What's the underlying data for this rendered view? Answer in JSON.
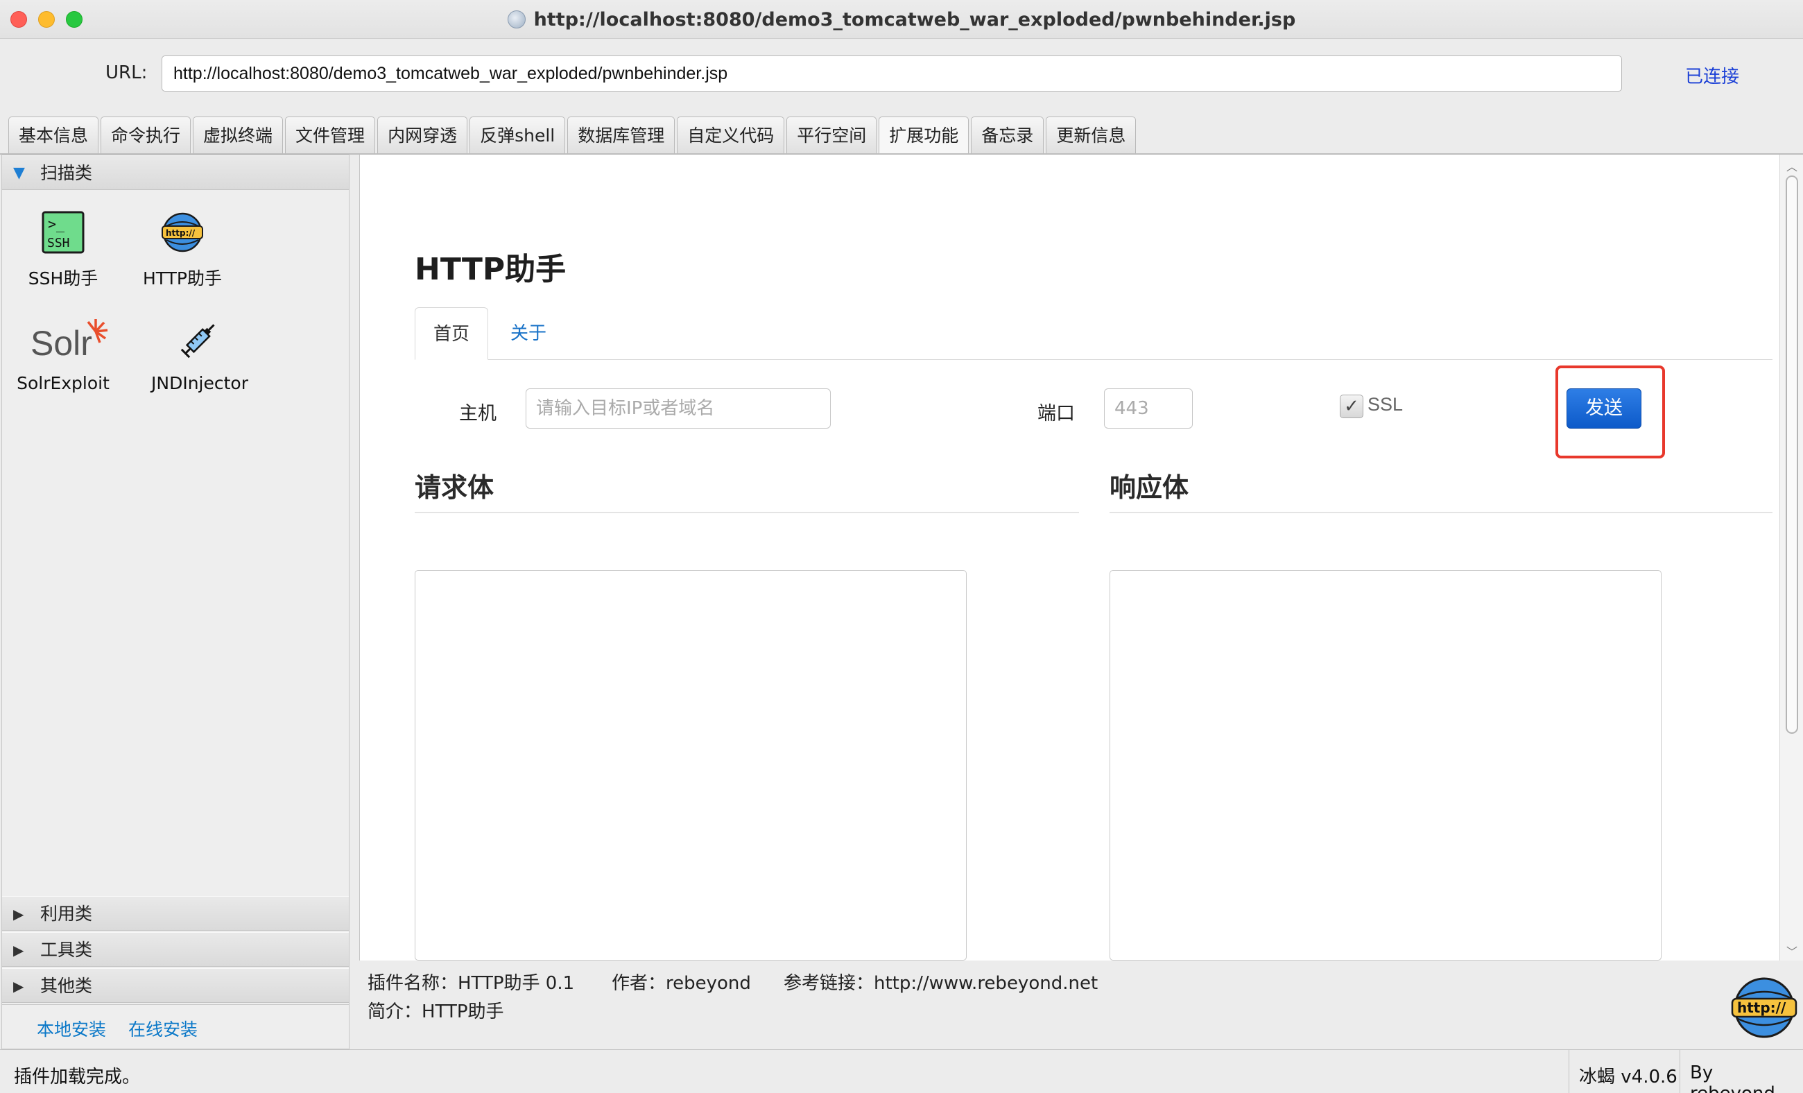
{
  "window": {
    "title": "http://localhost:8080/demo3_tomcatweb_war_exploded/pwnbehinder.jsp"
  },
  "urlbar": {
    "label": "URL:",
    "value": "http://localhost:8080/demo3_tomcatweb_war_exploded/pwnbehinder.jsp",
    "status": "已连接"
  },
  "tabs": [
    {
      "label": "基本信息"
    },
    {
      "label": "命令执行"
    },
    {
      "label": "虚拟终端"
    },
    {
      "label": "文件管理"
    },
    {
      "label": "内网穿透"
    },
    {
      "label": "反弹shell"
    },
    {
      "label": "数据库管理"
    },
    {
      "label": "自定义代码"
    },
    {
      "label": "平行空间"
    },
    {
      "label": "扩展功能",
      "active": true
    },
    {
      "label": "备忘录"
    },
    {
      "label": "更新信息"
    }
  ],
  "sidebar": {
    "sections": [
      {
        "label": "扫描类",
        "expanded": true
      },
      {
        "label": "利用类",
        "expanded": false
      },
      {
        "label": "工具类",
        "expanded": false
      },
      {
        "label": "其他类",
        "expanded": false
      }
    ],
    "plugins": [
      {
        "label": "SSH助手",
        "icon": "ssh-terminal-icon"
      },
      {
        "label": "HTTP助手",
        "icon": "http-globe-icon"
      },
      {
        "label": "SolrExploit",
        "icon": "solr-logo-icon"
      },
      {
        "label": "JNDInjector",
        "icon": "syringe-icon"
      }
    ],
    "install": {
      "local": "本地安装",
      "online": "在线安装"
    }
  },
  "plugin_page": {
    "title": "HTTP助手",
    "tabs": {
      "home": "首页",
      "about": "关于"
    },
    "host_label": "主机",
    "host_placeholder": "请输入目标IP或者域名",
    "port_label": "端口",
    "port_value": "443",
    "ssl_label": "SSL",
    "ssl_checked": true,
    "send_label": "发送",
    "request_title": "请求体",
    "response_title": "响应体"
  },
  "plugin_info": {
    "name": "插件名称：HTTP助手 0.1",
    "author": "作者：rebeyond",
    "link": "参考链接：http://www.rebeyond.net",
    "summary": "简介：HTTP助手",
    "logo_text": "http://"
  },
  "statusbar": {
    "message": "插件加载完成。",
    "version": "冰蝎 v4.0.6",
    "by": "By rebeyond"
  },
  "colors": {
    "accent": "#0d5ac9",
    "link": "#1a73c8",
    "connected": "#1a3fd6",
    "highlight": "#e8382c"
  }
}
